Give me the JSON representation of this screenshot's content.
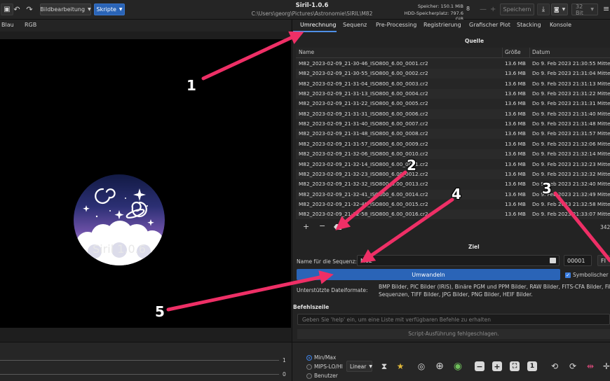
{
  "titlebar": {
    "app_title": "Siril-1.0.6",
    "path": "C:\\Users\\georg\\Pictures\\Astronomie\\SIRIL\\M82",
    "image_processing_label": "Bildbearbeitung",
    "scripts_label": "Skripte",
    "memory_label": "Speicher: 150.1 MiB",
    "disk_label": "HDD-Speicherplatz: 797.6 GiB",
    "thread_count": "8",
    "save_label": "Speichern",
    "bit_depth": "32 Bit"
  },
  "channel_tabs": [
    "Blau",
    "RGB"
  ],
  "logo_text": "Siril 1.0.6",
  "tabs": [
    "Umrechnung",
    "Sequenz",
    "Pre-Processing",
    "Registrierung",
    "Grafischer Plot",
    "Stacking",
    "Konsole"
  ],
  "source": {
    "title": "Quelle",
    "columns": [
      "Name",
      "Größe",
      "Datum"
    ],
    "files": [
      {
        "name": "M82_2023-02-09_21-30-46_ISO800_6.00_0001.cr2",
        "size": "13.6 MB",
        "date": "Do   9. Feb 2023 21:30:55 Mittele"
      },
      {
        "name": "M82_2023-02-09_21-30-55_ISO800_6.00_0002.cr2",
        "size": "13.6 MB",
        "date": "Do   9. Feb 2023 21:31:04 Mittele"
      },
      {
        "name": "M82_2023-02-09_21-31-04_ISO800_6.00_0003.cr2",
        "size": "13.6 MB",
        "date": "Do   9. Feb 2023 21:31:13 Mittele"
      },
      {
        "name": "M82_2023-02-09_21-31-13_ISO800_6.00_0004.cr2",
        "size": "13.6 MB",
        "date": "Do   9. Feb 2023 21:31:22 Mittele"
      },
      {
        "name": "M82_2023-02-09_21-31-22_ISO800_6.00_0005.cr2",
        "size": "13.6 MB",
        "date": "Do   9. Feb 2023 21:31:31 Mittele"
      },
      {
        "name": "M82_2023-02-09_21-31-31_ISO800_6.00_0006.cr2",
        "size": "13.6 MB",
        "date": "Do   9. Feb 2023 21:31:40 Mittele"
      },
      {
        "name": "M82_2023-02-09_21-31-40_ISO800_6.00_0007.cr2",
        "size": "13.6 MB",
        "date": "Do   9. Feb 2023 21:31:48 Mittele"
      },
      {
        "name": "M82_2023-02-09_21-31-48_ISO800_6.00_0008.cr2",
        "size": "13.6 MB",
        "date": "Do   9. Feb 2023 21:31:57 Mittele"
      },
      {
        "name": "M82_2023-02-09_21-31-57_ISO800_6.00_0009.cr2",
        "size": "13.6 MB",
        "date": "Do   9. Feb 2023 21:32:06 Mittele"
      },
      {
        "name": "M82_2023-02-09_21-32-06_ISO800_6.00_0010.cr2",
        "size": "13.6 MB",
        "date": "Do   9. Feb 2023 21:32:14 Mittele"
      },
      {
        "name": "M82_2023-02-09_21-32-14_ISO800_6.00_0011.cr2",
        "size": "13.6 MB",
        "date": "Do   9. Feb 2023 21:32:23 Mittele"
      },
      {
        "name": "M82_2023-02-09_21-32-23_ISO800_6.00_0012.cr2",
        "size": "13.6 MB",
        "date": "Do   9. Feb 2023 21:32:32 Mittele"
      },
      {
        "name": "M82_2023-02-09_21-32-32_ISO800_6.00_0013.cr2",
        "size": "13.6 MB",
        "date": "Do   9. Feb 2023 21:32:40 Mittele"
      },
      {
        "name": "M82_2023-02-09_21-32-41_ISO800_6.00_0014.cr2",
        "size": "13.6 MB",
        "date": "Do   9. Feb 2023 21:32:49 Mittele"
      },
      {
        "name": "M82_2023-02-09_21-32-49_ISO800_6.00_0015.cr2",
        "size": "13.6 MB",
        "date": "Do   9. Feb 2023 21:32:58 Mittele"
      },
      {
        "name": "M82_2023-02-09_21-32-58_ISO800_6.00_0016.cr2",
        "size": "13.6 MB",
        "date": "Do   9. Feb 2023 21:33:07 Mittele"
      }
    ],
    "file_count": "342"
  },
  "target": {
    "title": "Ziel",
    "sequence_name_label": "Name für die Sequenz:",
    "sequence_name_value": "M82",
    "start_index": "00001",
    "fits_label": "FI",
    "convert_label": "Umwandeln",
    "symlink_label": "Symbolischer L",
    "supported_label": "Unterstützte Dateiformate:",
    "supported_formats_line1": "BMP Bilder, PIC Bilder (IRIS), Binäre PGM und PPM Bilder, RAW Bilder, FITS-CFA Bilder, Filme/V",
    "supported_formats_line2": "Sequenzen, TIFF Bilder, JPG Bilder, PNG Bilder, HEIF Bilder."
  },
  "command_line": {
    "title": "Befehlszeile",
    "placeholder": "Geben Sie 'help' ein, um eine Liste mit verfügbaren Befehle zu erhalten",
    "status": "Script-Ausführung fehlgeschlagen."
  },
  "bottom": {
    "slider_top_value": "1",
    "slider_bottom_value": "0",
    "display_modes": [
      "Min/Max",
      "MIPS-LO/HI",
      "Benutzer"
    ],
    "selected_mode": "Min/Max",
    "scale_label": "Linear",
    "zoom_fit_label": "1"
  },
  "annotations": [
    "1",
    "2",
    "3",
    "4",
    "5"
  ],
  "colors": {
    "accent": "#2a64b7",
    "arrow": "#ee2f66"
  }
}
